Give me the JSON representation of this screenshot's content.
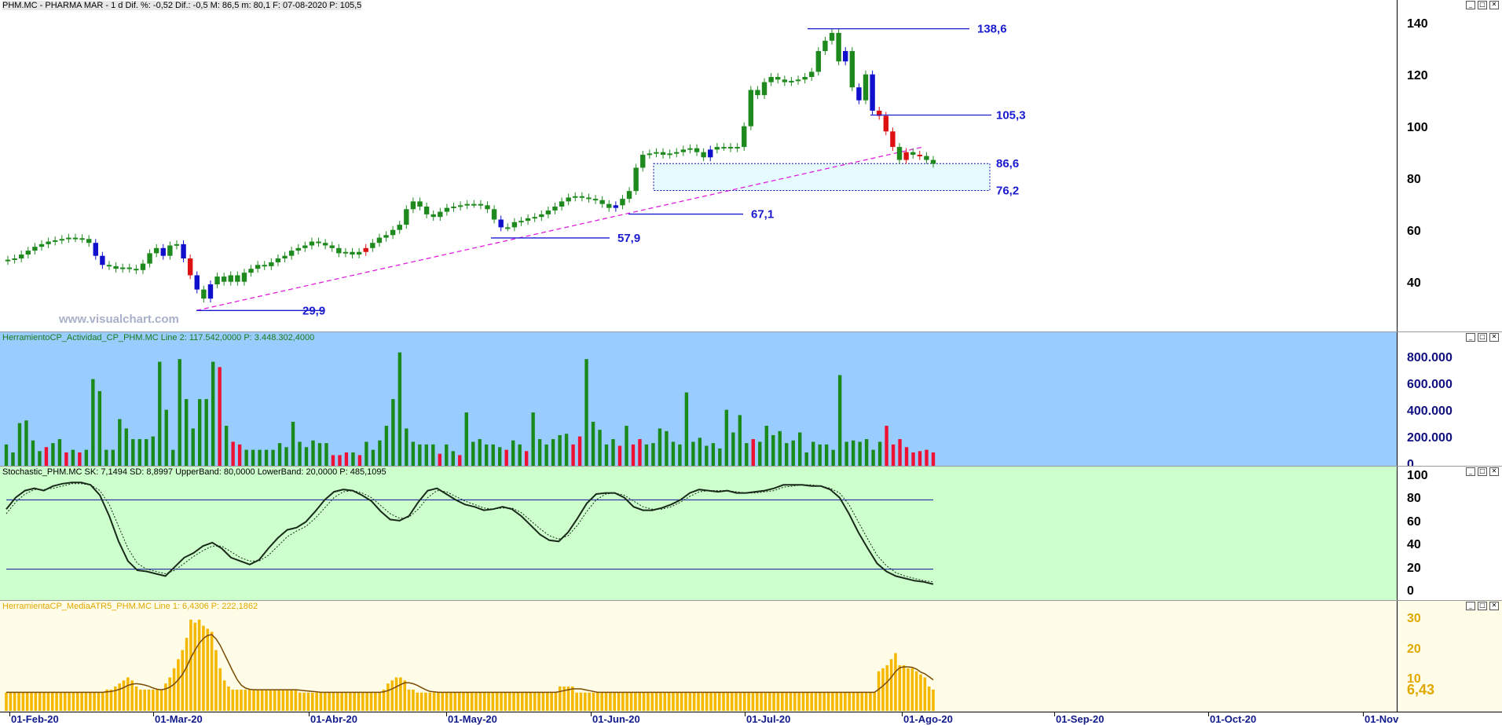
{
  "price_panel": {
    "title": "PHM.MC - PHARMA MAR -  1 d  Dif. %: -0,52  Dif.: -0,5  M: 86,5  m: 80,1  F: 07-08-2020  P: 105,5",
    "watermark": "www.visualchart.com",
    "yticks": [
      "140",
      "120",
      "100",
      "80",
      "60",
      "40"
    ],
    "annotations": [
      "138,6",
      "105,3",
      "86,6",
      "76,2",
      "67,1",
      "57,9",
      "29,9"
    ]
  },
  "volume_panel": {
    "title": "HerramientoCP_Actividad_CP_PHM.MC  Line 2: 117.542,0000  P: 3.448.302,4000",
    "yticks": [
      "800.000",
      "600.000",
      "400.000",
      "200.000",
      "0"
    ]
  },
  "stoch_panel": {
    "title": "Stochastic_PHM.MC  SK: 7,1494  SD: 8,8997  UpperBand: 80,0000  LowerBand: 20,0000  P: 485,1095",
    "yticks": [
      "100",
      "80",
      "60",
      "40",
      "20",
      "0"
    ]
  },
  "atr_panel": {
    "title": "HerramientaCP_MediaATR5_PHM.MC  Line 1: 6,4306  P: 222,1862",
    "yticks": [
      "30",
      "20",
      "10"
    ],
    "last_value": "6,43"
  },
  "date_axis": [
    "01-Feb-20",
    "01-Mar-20",
    "01-Abr-20",
    "01-May-20",
    "01-Jun-20",
    "01-Jul-20",
    "01-Ago-20",
    "01-Sep-20",
    "01-Oct-20",
    "01-Nov"
  ],
  "window_buttons": [
    "_",
    "□",
    "✕"
  ],
  "colors": {
    "up": "#1e8a1e",
    "down_blue": "#1010cc",
    "down_red": "#dd1111",
    "price_bg": "#ffffff",
    "volume_bg": "#99ccff",
    "stoch_bg": "#ccffcc",
    "atr_bg": "#fffde8",
    "atr_bar": "#f5b800"
  },
  "chart_data": [
    {
      "type": "candlestick",
      "title": "PHM.MC - PHARMA MAR",
      "x_range": [
        "01-Feb-20",
        "01-Nov"
      ],
      "ylim": [
        22,
        146
      ],
      "levels": [
        138.6,
        105.3,
        86.6,
        76.2,
        67.1,
        57.9,
        29.9
      ],
      "closes": [
        49.5,
        50,
        51.5,
        53,
        54.5,
        55.5,
        56.5,
        57,
        57.5,
        58,
        57.8,
        57.5,
        56,
        51,
        47.5,
        47,
        46,
        46.5,
        46,
        45.5,
        48,
        52,
        54,
        51,
        55,
        55.5,
        50,
        43.5,
        38,
        34.5,
        40,
        43,
        41,
        43.5,
        41,
        44.5,
        46,
        47.5,
        47,
        48.5,
        50,
        51,
        53,
        54,
        55,
        56.5,
        56,
        55,
        54,
        52,
        52.5,
        51.5,
        52.5,
        54,
        56,
        58,
        59,
        61,
        63,
        69,
        72,
        70,
        67,
        66,
        68,
        69.5,
        70,
        70.5,
        71,
        71,
        70.5,
        69,
        65,
        62,
        62,
        64,
        64.5,
        65.5,
        66,
        67,
        68.5,
        70,
        72,
        73.5,
        74,
        73.5,
        73,
        72.5,
        71,
        69.5,
        70.5,
        73,
        76,
        85,
        90,
        90.5,
        91,
        90,
        90.5,
        91,
        92,
        92.5,
        91,
        89,
        92,
        93,
        93,
        92.5,
        93,
        101,
        115,
        113,
        118,
        120,
        119,
        118,
        118.5,
        119,
        120,
        122,
        130,
        134,
        137,
        126,
        130,
        116,
        111,
        121,
        107,
        105,
        99,
        93,
        88,
        91,
        90,
        89.5,
        88,
        86.5
      ],
      "colors": [
        "up",
        "up",
        "up",
        "up",
        "up",
        "up",
        "up",
        "up",
        "up",
        "up",
        "up",
        "up",
        "up",
        "blue",
        "blue",
        "up",
        "up",
        "up",
        "up",
        "up",
        "up",
        "up",
        "up",
        "blue",
        "up",
        "up",
        "blue",
        "red",
        "blue",
        "up",
        "blue",
        "up",
        "up",
        "up",
        "up",
        "up",
        "up",
        "up",
        "up",
        "up",
        "up",
        "up",
        "up",
        "up",
        "up",
        "up",
        "up",
        "up",
        "up",
        "up",
        "up",
        "up",
        "up",
        "red",
        "up",
        "up",
        "up",
        "up",
        "up",
        "up",
        "up",
        "up",
        "up",
        "up",
        "up",
        "up",
        "up",
        "up",
        "up",
        "up",
        "up",
        "up",
        "up",
        "blue",
        "up",
        "up",
        "up",
        "up",
        "up",
        "up",
        "up",
        "up",
        "up",
        "up",
        "up",
        "up",
        "up",
        "up",
        "up",
        "up",
        "blue",
        "up",
        "up",
        "up",
        "up",
        "up",
        "up",
        "up",
        "up",
        "up",
        "up",
        "up",
        "up",
        "up",
        "blue",
        "up",
        "up",
        "up",
        "up",
        "up",
        "up",
        "up",
        "up",
        "up",
        "up",
        "up",
        "up",
        "up",
        "up",
        "up",
        "up",
        "up",
        "up",
        "up",
        "blue",
        "up",
        "blue",
        "up",
        "blue",
        "red",
        "red",
        "red",
        "up",
        "red",
        "up",
        "red"
      ]
    },
    {
      "type": "bar",
      "title": "HerramientoCP_Actividad_CP_PHM.MC",
      "ylim": [
        0,
        880000
      ],
      "values": [
        160000,
        100000,
        320000,
        340000,
        190000,
        110000,
        140000,
        170000,
        200000,
        100000,
        120000,
        100000,
        120000,
        650000,
        560000,
        120000,
        120000,
        350000,
        280000,
        200000,
        200000,
        200000,
        220000,
        780000,
        420000,
        120000,
        800000,
        500000,
        280000,
        500000,
        500000,
        780000,
        740000,
        300000,
        180000,
        160000,
        120000,
        120000,
        120000,
        120000,
        120000,
        170000,
        140000,
        330000,
        180000,
        140000,
        190000,
        170000,
        170000,
        80000,
        80000,
        100000,
        100000,
        80000,
        180000,
        120000,
        190000,
        300000,
        500000,
        850000,
        280000,
        180000,
        160000,
        160000,
        160000,
        90000,
        160000,
        110000,
        80000,
        400000,
        180000,
        200000,
        160000,
        160000,
        140000,
        120000,
        190000,
        160000,
        110000,
        400000,
        200000,
        160000,
        200000,
        230000,
        240000,
        160000,
        220000,
        800000,
        330000,
        270000,
        160000,
        200000,
        150000,
        300000,
        160000,
        200000,
        160000,
        170000,
        280000,
        260000,
        180000,
        160000,
        550000,
        180000,
        210000,
        150000,
        170000,
        130000,
        420000,
        250000,
        380000,
        170000,
        200000,
        180000,
        300000,
        230000,
        260000,
        170000,
        190000,
        250000,
        100000,
        180000,
        160000,
        160000,
        120000,
        680000,
        180000,
        190000,
        180000,
        200000,
        120000,
        180000,
        300000,
        160000,
        200000,
        140000,
        100000,
        110000,
        120000,
        100000
      ],
      "colors": [
        "green",
        "green",
        "green",
        "green",
        "green",
        "green",
        "red",
        "green",
        "green",
        "red",
        "green",
        "red",
        "green",
        "green",
        "green",
        "green",
        "green",
        "green",
        "green",
        "green",
        "green",
        "green",
        "green",
        "green",
        "green",
        "green",
        "green",
        "green",
        "green",
        "green",
        "green",
        "green",
        "red",
        "green",
        "red",
        "red",
        "green",
        "green",
        "green",
        "green",
        "green",
        "green",
        "green",
        "green",
        "green",
        "green",
        "green",
        "green",
        "green",
        "red",
        "red",
        "red",
        "green",
        "red",
        "green",
        "green",
        "green",
        "green",
        "green",
        "green",
        "green",
        "green",
        "green",
        "green",
        "green",
        "red",
        "green",
        "green",
        "red",
        "green",
        "green",
        "green",
        "green",
        "green",
        "green",
        "red",
        "green",
        "green",
        "red",
        "green",
        "green",
        "green",
        "green",
        "green",
        "green",
        "red",
        "red",
        "green",
        "green",
        "green",
        "green",
        "green",
        "red",
        "green",
        "red",
        "red",
        "green",
        "green",
        "green",
        "green",
        "green",
        "green",
        "green",
        "green",
        "green",
        "green",
        "green",
        "green",
        "green",
        "green",
        "green",
        "green",
        "red",
        "green",
        "green",
        "green",
        "green",
        "green",
        "green",
        "green",
        "green",
        "green",
        "green",
        "green",
        "green",
        "green",
        "green",
        "green",
        "green",
        "green",
        "green",
        "green",
        "red",
        "red",
        "red",
        "red",
        "red",
        "red",
        "red",
        "red"
      ]
    },
    {
      "type": "line",
      "title": "Stochastic_PHM.MC",
      "ylim": [
        0,
        100
      ],
      "bands": [
        80,
        20
      ],
      "series": [
        {
          "name": "SK",
          "values": [
            72,
            82,
            88,
            90,
            88,
            92,
            94,
            95,
            95,
            93,
            84,
            66,
            44,
            27,
            19,
            18,
            16,
            14,
            22,
            30,
            34,
            40,
            43,
            38,
            30,
            27,
            24,
            28,
            38,
            47,
            54,
            56,
            61,
            70,
            80,
            87,
            89,
            88,
            84,
            79,
            70,
            63,
            62,
            66,
            78,
            88,
            90,
            85,
            80,
            76,
            74,
            71,
            72,
            74,
            72,
            66,
            58,
            50,
            45,
            44,
            52,
            64,
            77,
            85,
            86,
            86,
            82,
            74,
            71,
            71,
            73,
            76,
            80,
            86,
            89,
            88,
            87,
            88,
            86,
            86,
            87,
            88,
            90,
            93,
            93,
            93,
            92,
            92,
            89,
            82,
            68,
            52,
            38,
            25,
            18,
            14,
            12,
            10,
            9,
            7
          ]
        },
        {
          "name": "SD",
          "values": [
            68,
            78,
            85,
            89,
            89,
            90,
            92,
            94,
            94,
            93,
            88,
            76,
            57,
            38,
            25,
            20,
            18,
            16,
            19,
            25,
            31,
            36,
            40,
            40,
            35,
            30,
            27,
            27,
            32,
            40,
            48,
            53,
            57,
            64,
            73,
            82,
            87,
            88,
            86,
            82,
            75,
            68,
            64,
            65,
            72,
            82,
            88,
            87,
            83,
            79,
            76,
            73,
            72,
            73,
            73,
            69,
            62,
            55,
            49,
            46,
            49,
            58,
            70,
            80,
            85,
            86,
            84,
            79,
            74,
            72,
            72,
            74,
            78,
            83,
            87,
            88,
            88,
            88,
            87,
            86,
            86,
            87,
            88,
            91,
            92,
            93,
            93,
            92,
            90,
            86,
            76,
            61,
            46,
            32,
            23,
            17,
            14,
            12,
            10,
            9
          ]
        }
      ]
    },
    {
      "type": "bar",
      "title": "HerramientaCP_MediaATR5_PHM.MC",
      "ylim": [
        0,
        33
      ],
      "values": [
        6,
        6,
        6,
        6,
        6,
        6,
        6,
        6,
        6,
        6,
        6,
        6,
        6,
        6,
        6,
        6,
        6,
        6,
        6,
        6,
        6,
        6,
        6,
        6,
        7,
        7,
        8,
        9,
        10,
        11,
        10,
        8,
        7,
        7,
        7,
        7,
        7,
        7,
        9,
        11,
        14,
        17,
        20,
        24,
        30,
        29,
        30,
        28,
        27,
        26,
        20,
        14,
        10,
        8,
        7,
        7,
        7,
        7,
        7,
        7,
        7,
        7,
        7,
        7,
        7,
        7,
        7,
        7,
        7,
        7,
        6,
        6,
        6,
        6,
        6,
        6,
        6,
        6,
        6,
        6,
        6,
        6,
        6,
        6,
        6,
        6,
        6,
        6,
        6,
        6,
        7,
        9,
        10,
        11,
        11,
        10,
        7,
        7,
        6,
        6,
        6,
        6,
        6,
        6,
        6,
        6,
        6,
        6,
        6,
        6,
        6,
        6,
        6,
        6,
        6,
        6,
        6,
        6,
        6,
        6,
        6,
        6,
        6,
        6,
        6,
        6,
        6,
        6,
        6,
        6,
        6,
        6,
        8,
        8,
        8,
        8,
        6,
        6,
        6,
        6,
        6,
        6,
        6,
        6,
        6,
        6,
        6,
        6,
        6,
        6,
        6,
        6,
        6,
        6,
        6,
        6,
        6,
        6,
        6,
        6,
        6,
        6,
        6,
        6,
        6,
        6,
        6,
        6,
        6,
        6,
        6,
        6,
        6,
        6,
        6,
        6,
        6,
        6,
        6,
        6,
        6,
        6,
        6,
        6,
        6,
        6,
        6,
        6,
        6,
        6,
        6,
        6,
        6,
        6,
        6,
        6,
        6,
        6,
        6,
        6,
        6,
        6,
        6,
        6,
        6,
        6,
        6,
        6,
        13,
        14,
        15,
        17,
        19,
        15,
        15,
        14,
        14,
        13,
        12,
        11,
        8,
        7
      ],
      "series": [
        {
          "name": "Line 1",
          "values_last": 6.43
        }
      ]
    }
  ]
}
